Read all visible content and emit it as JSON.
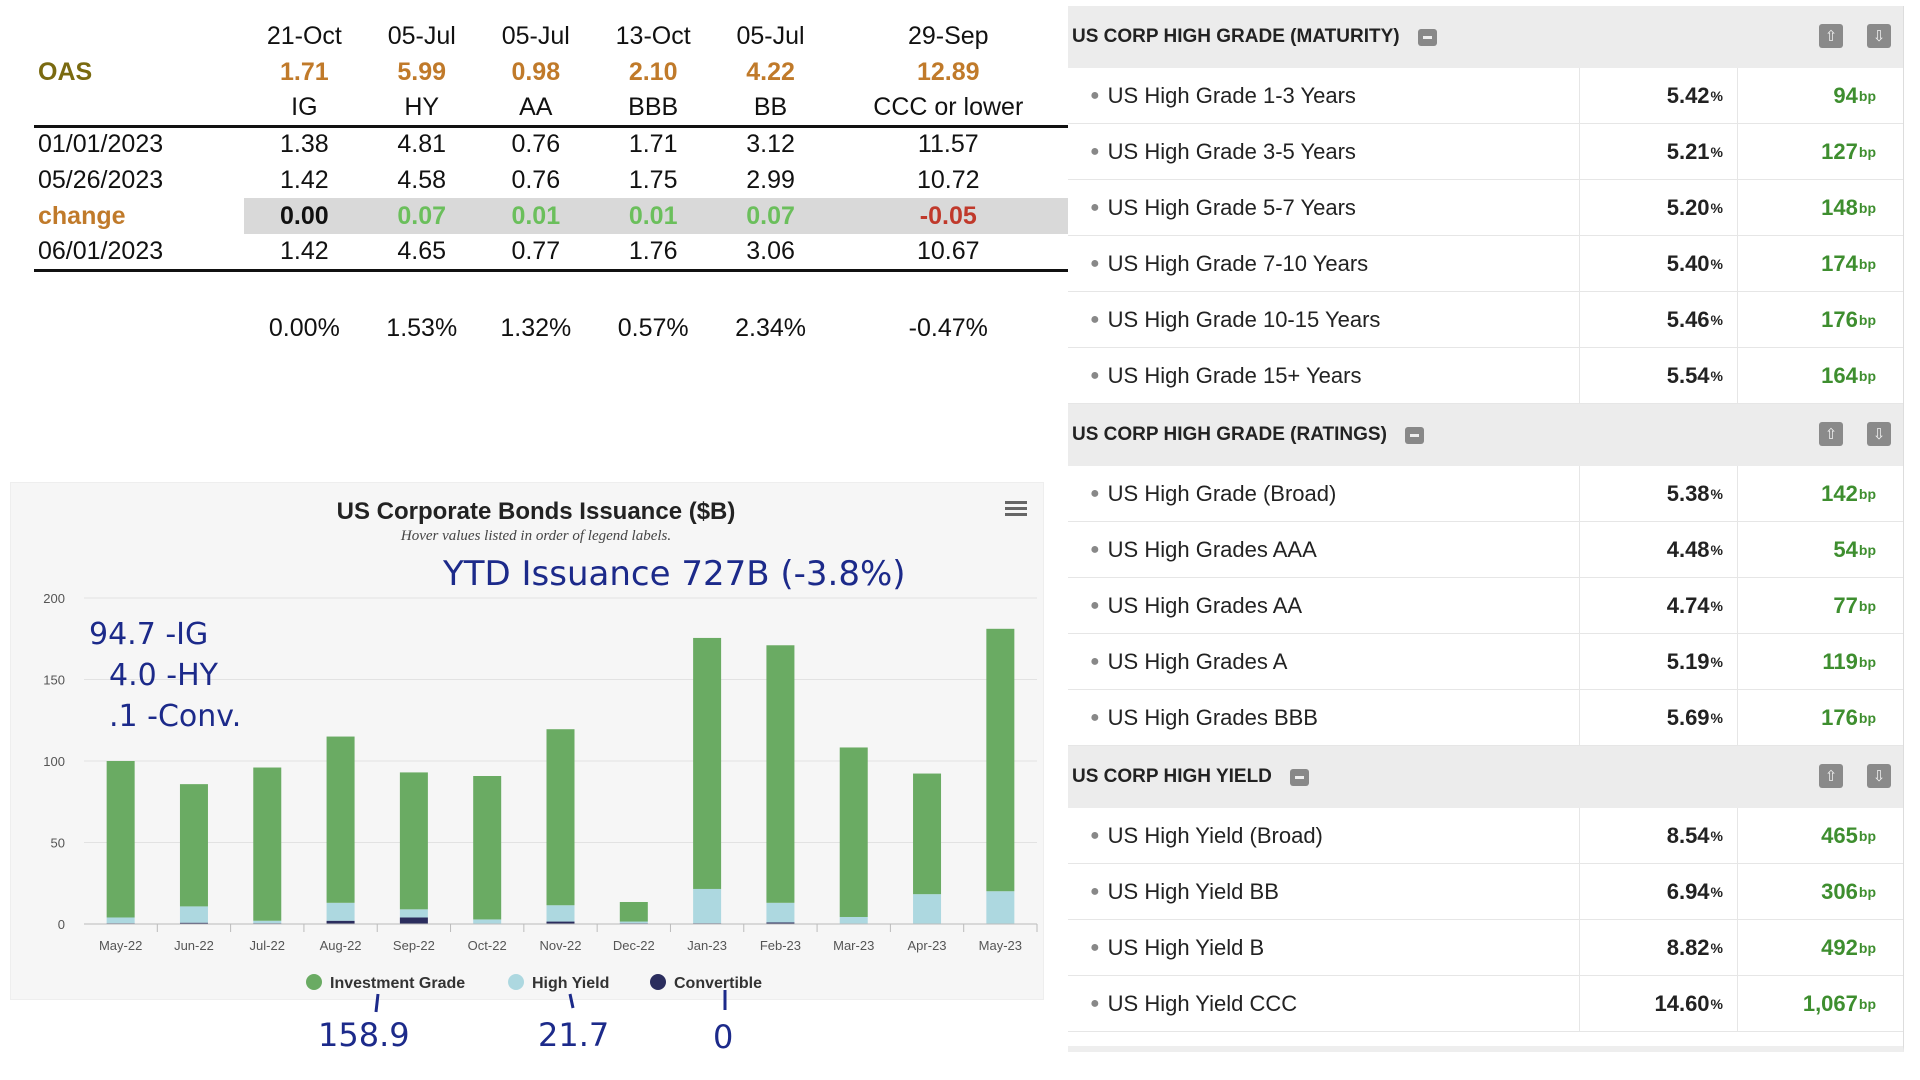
{
  "oas_table": {
    "dates": [
      "21-Oct",
      "05-Jul",
      "05-Jul",
      "13-Oct",
      "05-Jul",
      "29-Sep"
    ],
    "oas_label": "OAS",
    "oas_values": [
      "1.71",
      "5.99",
      "0.98",
      "2.10",
      "4.22",
      "12.89"
    ],
    "column_names": [
      "IG",
      "HY",
      "AA",
      "BBB",
      "BB",
      "CCC or lower"
    ],
    "rows": [
      {
        "label": "01/01/2023",
        "values": [
          "1.38",
          "4.81",
          "0.76",
          "1.71",
          "3.12",
          "11.57"
        ]
      },
      {
        "label": "05/26/2023",
        "values": [
          "1.42",
          "4.58",
          "0.76",
          "1.75",
          "2.99",
          "10.72"
        ]
      },
      {
        "label": "change",
        "values": [
          "0.00",
          "0.07",
          "0.01",
          "0.01",
          "0.07",
          "-0.05"
        ]
      },
      {
        "label": "06/01/2023",
        "values": [
          "1.42",
          "4.65",
          "0.77",
          "1.76",
          "3.06",
          "10.67"
        ]
      }
    ],
    "pct_changes": [
      "0.00%",
      "1.53%",
      "1.32%",
      "0.57%",
      "2.34%",
      "-0.47%"
    ]
  },
  "chart": {
    "menu_icon": "hamburger-menu-icon",
    "handwritten": {
      "ytd": "YTD Issuance 727B (-3.8%)",
      "breakdown": [
        "94.7 -IG",
        "4.0 -HY",
        ".1 -Conv."
      ],
      "totals": [
        "158.9",
        "21.7",
        "0"
      ]
    }
  },
  "chart_data": {
    "type": "bar",
    "title": "US Corporate Bonds Issuance ($B)",
    "subtitle": "Hover values listed in order of legend labels.",
    "categories": [
      "May-22",
      "Jun-22",
      "Jul-22",
      "Aug-22",
      "Sep-22",
      "Oct-22",
      "Nov-22",
      "Dec-22",
      "Jan-23",
      "Feb-23",
      "Mar-23",
      "Apr-23",
      "May-23"
    ],
    "stacked": true,
    "ylim": [
      0,
      200
    ],
    "yticks": [
      0,
      50,
      100,
      150,
      200
    ],
    "series": [
      {
        "name": "Convertible",
        "color": "#2b2d5e",
        "values": [
          0.5,
          0.8,
          0.5,
          2,
          4,
          0.3,
          1.5,
          0.5,
          0.5,
          1,
          0.3,
          0.3,
          0.1
        ]
      },
      {
        "name": "High Yield",
        "color": "#add8e0",
        "values": [
          3.5,
          10,
          1.5,
          11,
          5,
          2.5,
          10,
          1,
          21,
          12,
          4,
          18,
          20
        ]
      },
      {
        "name": "Investment Grade",
        "color": "#6aab63",
        "values": [
          96,
          75,
          94,
          102,
          84,
          88,
          108,
          12,
          154,
          158,
          104,
          74,
          161
        ]
      }
    ],
    "legend_order": [
      "Investment Grade",
      "High Yield",
      "Convertible"
    ],
    "legend_colors": [
      "#6aab63",
      "#add8e0",
      "#2b2d5e"
    ],
    "legend_position": "bottom-center",
    "grid": true
  },
  "yields": {
    "sections": [
      {
        "title": "US CORP HIGH GRADE (MATURITY)",
        "rows": [
          {
            "name": "US High Grade 1-3 Years",
            "yield": "5.42",
            "spread": "94"
          },
          {
            "name": "US High Grade 3-5 Years",
            "yield": "5.21",
            "spread": "127"
          },
          {
            "name": "US High Grade 5-7 Years",
            "yield": "5.20",
            "spread": "148"
          },
          {
            "name": "US High Grade 7-10 Years",
            "yield": "5.40",
            "spread": "174"
          },
          {
            "name": "US High Grade 10-15 Years",
            "yield": "5.46",
            "spread": "176"
          },
          {
            "name": "US High Grade 15+ Years",
            "yield": "5.54",
            "spread": "164"
          }
        ]
      },
      {
        "title": "US CORP HIGH GRADE (RATINGS)",
        "rows": [
          {
            "name": "US High Grade (Broad)",
            "yield": "5.38",
            "spread": "142"
          },
          {
            "name": "US High Grades AAA",
            "yield": "4.48",
            "spread": "54"
          },
          {
            "name": "US High Grades AA",
            "yield": "4.74",
            "spread": "77"
          },
          {
            "name": "US High Grades A",
            "yield": "5.19",
            "spread": "119"
          },
          {
            "name": "US High Grades BBB",
            "yield": "5.69",
            "spread": "176"
          }
        ]
      },
      {
        "title": "US CORP HIGH YIELD",
        "rows": [
          {
            "name": "US High Yield (Broad)",
            "yield": "8.54",
            "spread": "465"
          },
          {
            "name": "US High Yield BB",
            "yield": "6.94",
            "spread": "306"
          },
          {
            "name": "US High Yield B",
            "yield": "8.82",
            "spread": "492"
          },
          {
            "name": "US High Yield CCC",
            "yield": "14.60",
            "spread": "1,067"
          }
        ]
      }
    ],
    "pct_unit": "%",
    "bp_unit": "bp",
    "up_icon": "arrow-up-icon",
    "down_icon": "arrow-down-icon",
    "collapse_icon": "collapse-minus-icon"
  }
}
